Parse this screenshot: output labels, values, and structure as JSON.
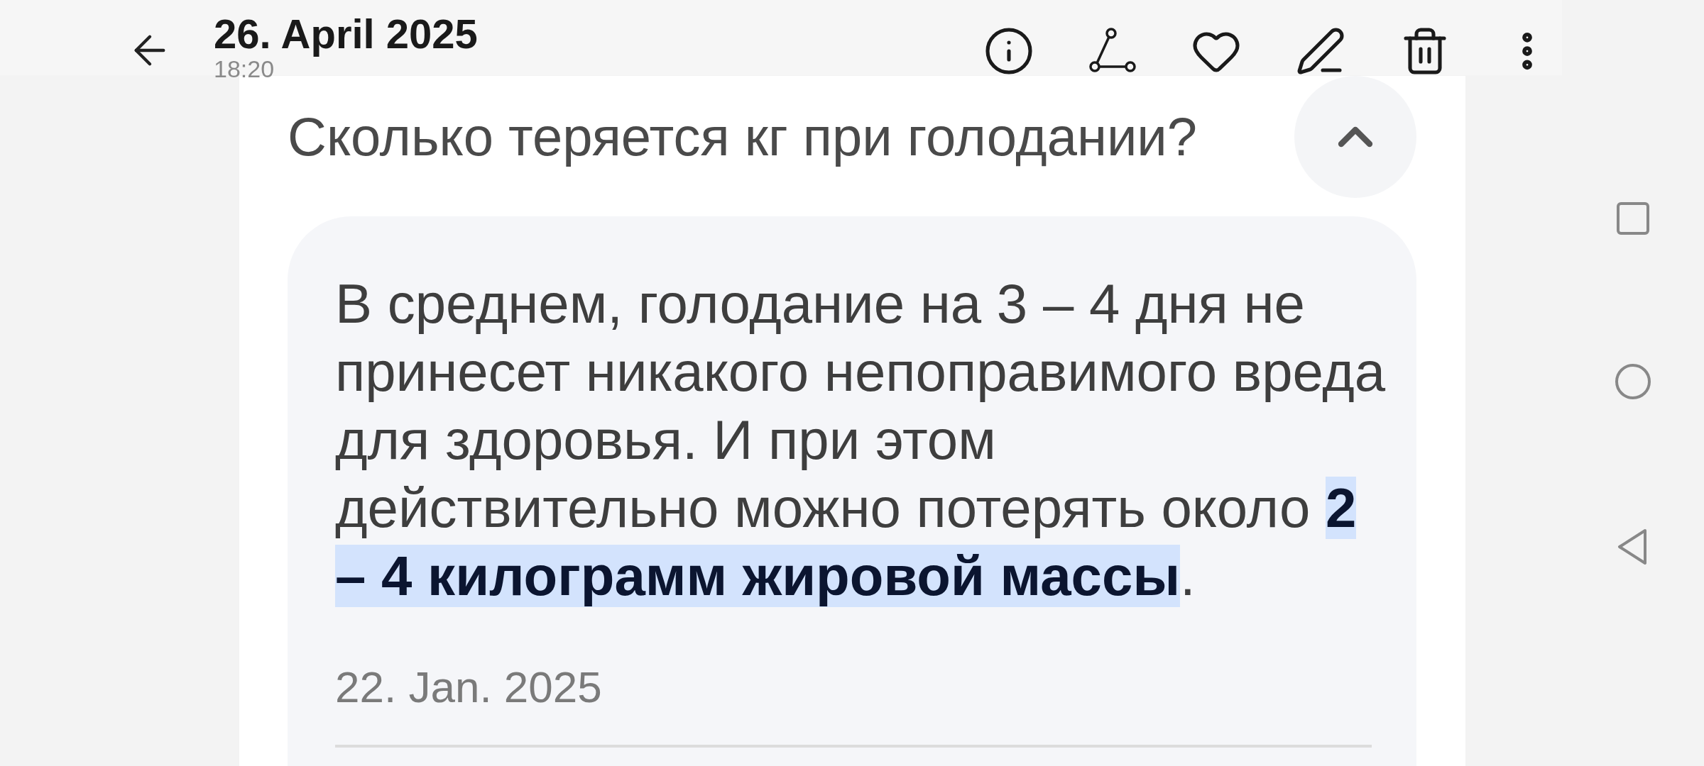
{
  "header": {
    "title": "26. April 2025",
    "time": "18:20"
  },
  "question": {
    "text": "Сколько теряется кг при голодании?",
    "expanded": true
  },
  "answer": {
    "text_before": "В среднем, голодание на 3 – 4 дня не принесет никакого непоправимого вреда для здоровья. И при этом действительно можно потерять около ",
    "highlight": "2 – 4 килограмм жировой массы",
    "text_after": ".",
    "date": "22. Jan. 2025"
  }
}
